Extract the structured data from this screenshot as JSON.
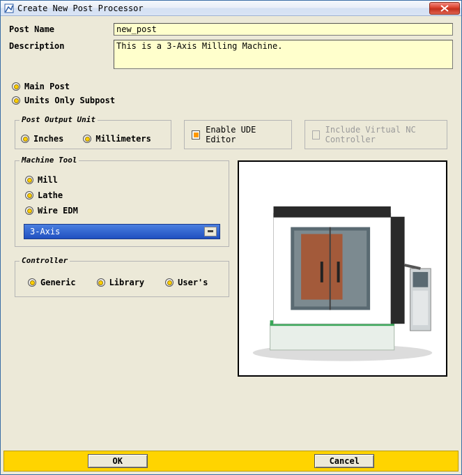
{
  "window": {
    "title": "Create New Post Processor"
  },
  "form": {
    "post_name_label": "Post Name",
    "post_name_value": "new_post",
    "description_label": "Description",
    "description_value": "This is a 3-Axis Milling Machine."
  },
  "post_type": {
    "main_label": "Main Post",
    "subpost_label": "Units Only Subpost",
    "selected": "main"
  },
  "output_unit": {
    "legend": "Post Output Unit",
    "inches_label": "Inches",
    "mm_label": "Millimeters",
    "selected": "inches"
  },
  "ude": {
    "label": "Enable UDE Editor",
    "checked": true
  },
  "vnc": {
    "label": "Include Virtual NC Controller",
    "enabled": false,
    "checked": false
  },
  "machine_tool": {
    "legend": "Machine Tool",
    "mill_label": "Mill",
    "lathe_label": "Lathe",
    "wire_label": "Wire EDM",
    "selected": "mill",
    "axis_selected": "3-Axis"
  },
  "controller": {
    "legend": "Controller",
    "generic_label": "Generic",
    "library_label": "Library",
    "users_label": "User's",
    "selected": "generic"
  },
  "buttons": {
    "ok": "OK",
    "cancel": "Cancel"
  }
}
